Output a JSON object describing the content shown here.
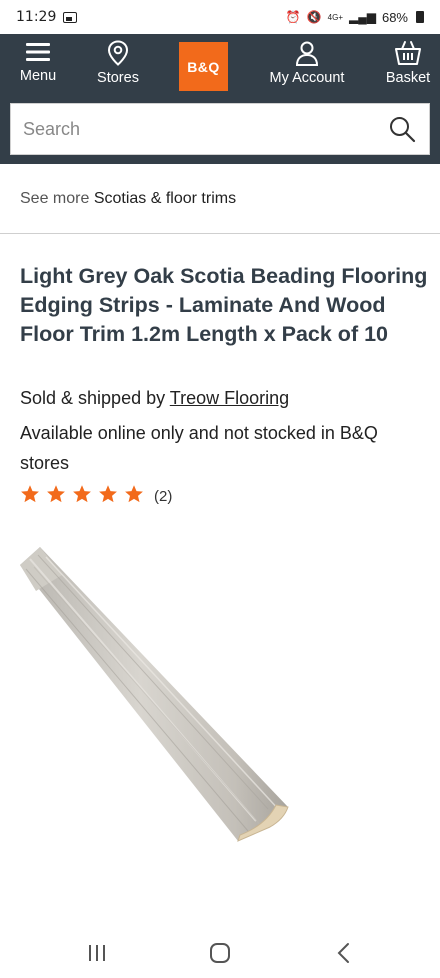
{
  "status_bar": {
    "time": "11:29",
    "network": "4G+",
    "battery": "68%"
  },
  "header": {
    "nav": {
      "menu_label": "Menu",
      "stores_label": "Stores",
      "logo_text": "B&Q",
      "account_label": "My Account",
      "basket_label": "Basket"
    },
    "search": {
      "placeholder": "Search"
    }
  },
  "breadcrumb": {
    "prefix": "See more ",
    "link_text": "Scotias & floor trims"
  },
  "product": {
    "title": "Light Grey Oak Scotia Beading Flooring Edging Strips - Laminate And Wood Floor Trim 1.2m Length x Pack of 10",
    "sold_by_prefix": "Sold & shipped by ",
    "seller": "Treow Flooring",
    "availability": "Available online only and not stocked in B&Q stores",
    "rating": {
      "stars": 5,
      "max_stars": 5,
      "count_text": "(2)"
    }
  },
  "colors": {
    "header_bg": "#333e48",
    "brand_orange": "#f26a1b",
    "star": "#f26a1b",
    "title": "#333e48"
  },
  "icons": {
    "menu": "hamburger-icon",
    "stores": "location-pin-icon",
    "account": "person-icon",
    "basket": "basket-icon",
    "search": "search-icon",
    "star": "star-icon",
    "android_recent": "recent-apps-icon",
    "android_home": "home-icon",
    "android_back": "back-icon"
  }
}
